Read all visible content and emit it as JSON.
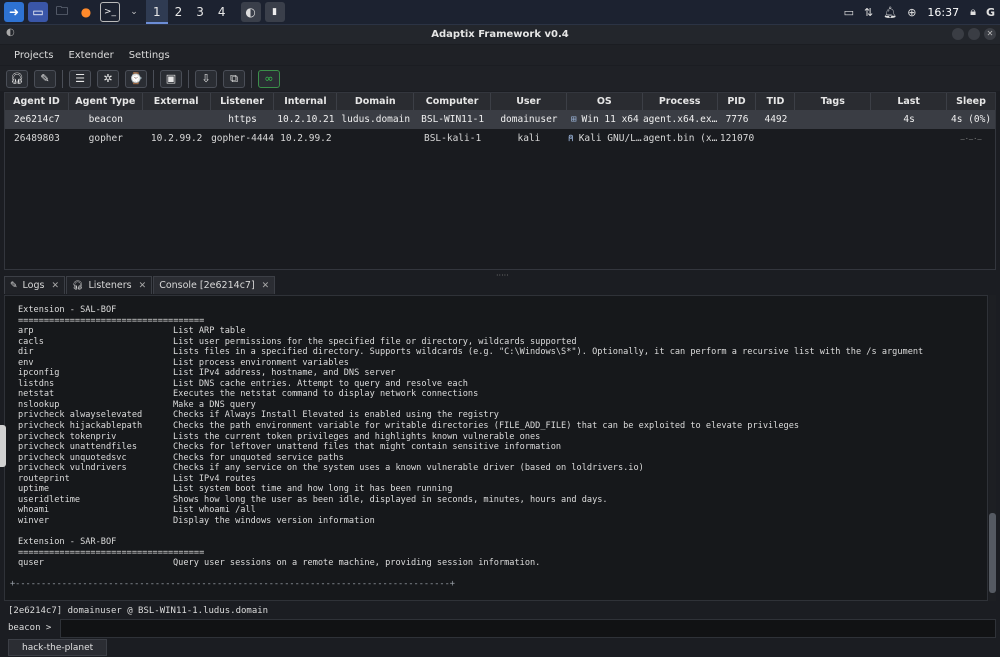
{
  "taskbar": {
    "workspaces": [
      "1",
      "2",
      "3",
      "4"
    ],
    "active_workspace": "1",
    "clock": "16:37",
    "user_initial": "G"
  },
  "window": {
    "title": "Adaptix Framework v0.4"
  },
  "menu": [
    "Projects",
    "Extender",
    "Settings"
  ],
  "sessions": {
    "columns": [
      "Agent ID",
      "Agent Type",
      "External",
      "Listener",
      "Internal",
      "Domain",
      "Computer",
      "User",
      "OS",
      "Process",
      "PID",
      "TID",
      "Tags",
      "Last",
      "Sleep"
    ],
    "rows": [
      [
        "2e6214c7",
        "beacon",
        "",
        "https",
        "10.2.10.21",
        "ludus.domain",
        "BSL-WIN11-1",
        "domainuser",
        "Win 11 x64",
        "agent.x64.ex…",
        "7776",
        "4492",
        "",
        "4s",
        "4s (0%)"
      ],
      [
        "26489803",
        "gopher",
        "10.2.99.2",
        "gopher-4444",
        "10.2.99.2",
        "",
        "BSL-kali-1",
        "kali",
        "Kali GNU/L…",
        "agent.bin (x…",
        "121070",
        "",
        "",
        "",
        "—·—·—"
      ]
    ]
  },
  "tabs": [
    {
      "label": "Logs"
    },
    {
      "label": "Listeners"
    },
    {
      "label": "Console [2e6214c7]"
    }
  ],
  "console": {
    "lines": [
      {
        "t": "Extension - SAL-BOF"
      },
      {
        "t": "===================================="
      },
      {
        "c": "arp",
        "d": "List ARP table"
      },
      {
        "c": "cacls",
        "d": "List user permissions for the specified file or directory, wildcards supported"
      },
      {
        "c": "dir",
        "d": "Lists files in a specified directory. Supports wildcards (e.g. \"C:\\Windows\\S*\"). Optionally, it can perform a recursive list with the /s argument"
      },
      {
        "c": "env",
        "d": "List process environment variables"
      },
      {
        "c": "ipconfig",
        "d": "List IPv4 address, hostname, and DNS server"
      },
      {
        "c": "listdns",
        "d": "List DNS cache entries. Attempt to query and resolve each"
      },
      {
        "c": "netstat",
        "d": "Executes the netstat command to display network connections"
      },
      {
        "c": "nslookup",
        "d": "Make a DNS query"
      },
      {
        "c": "privcheck alwayselevated",
        "d": "Checks if Always Install Elevated is enabled using the registry"
      },
      {
        "c": "privcheck hijackablepath",
        "d": "Checks the path environment variable for writable directories (FILE_ADD_FILE) that can be exploited to elevate privileges"
      },
      {
        "c": "privcheck tokenpriv",
        "d": "Lists the current token privileges and highlights known vulnerable ones"
      },
      {
        "c": "privcheck unattendfiles",
        "d": "Checks for leftover unattend files that might contain sensitive information"
      },
      {
        "c": "privcheck unquotedsvc",
        "d": "Checks for unquoted service paths"
      },
      {
        "c": "privcheck vulndrivers",
        "d": "Checks if any service on the system uses a known vulnerable driver (based on loldrivers.io)"
      },
      {
        "c": "routeprint",
        "d": "List IPv4 routes"
      },
      {
        "c": "uptime",
        "d": "List system boot time and how long it has been running"
      },
      {
        "c": "useridletime",
        "d": "Shows how long the user as been idle, displayed in seconds, minutes, hours and days."
      },
      {
        "c": "whoami",
        "d": "List whoami /all"
      },
      {
        "c": "winver",
        "d": "Display the windows version information"
      },
      {
        "t": ""
      },
      {
        "t": "Extension - SAR-BOF"
      },
      {
        "t": "===================================="
      },
      {
        "c": "quser",
        "d": "Query user sessions on a remote machine, providing session information."
      },
      {
        "t": ""
      },
      {
        "t": "+------------------------------------------------------------------------------------+",
        "sep": true
      }
    ]
  },
  "status": "[2e6214c7] domainuser @ BSL-WIN11-1.ludus.domain",
  "prompt": "beacon >",
  "input_value": "",
  "bottom_tab": "hack-the-planet"
}
